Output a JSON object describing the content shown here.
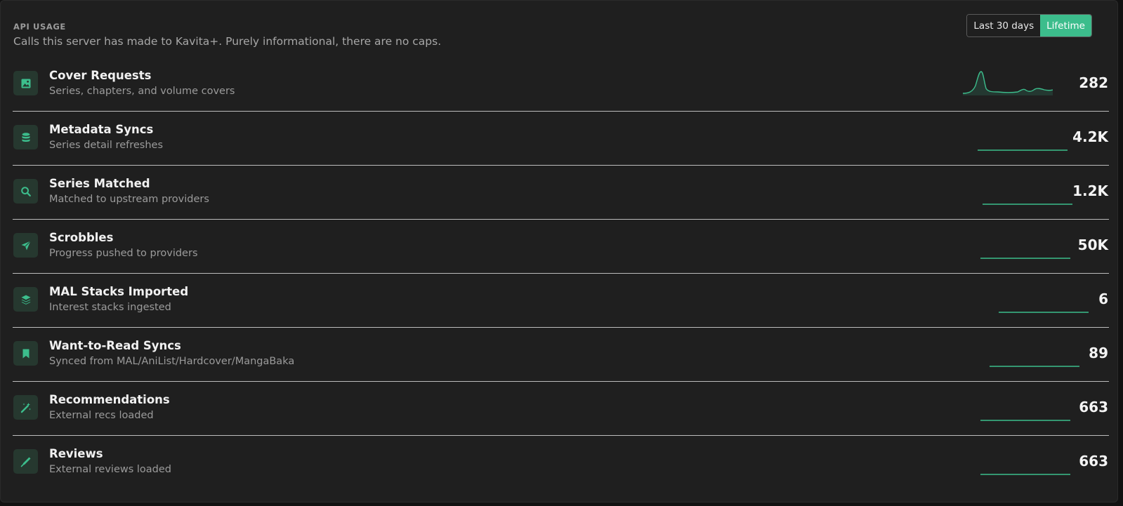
{
  "section": {
    "title": "API USAGE",
    "description": "Calls this server has made to Kavita+. Purely informational, there are no caps."
  },
  "range_toggle": {
    "options": [
      "Last 30 days",
      "Lifetime"
    ],
    "selected": "Lifetime"
  },
  "colors": {
    "accent": "#3cbd8c",
    "icon_bg": "#26382f",
    "panel_bg": "#1f1f1f"
  },
  "metrics": [
    {
      "title": "Cover Requests",
      "subtitle": "Series, chapters, and volume covers",
      "value": "282",
      "icon": "image-icon"
    },
    {
      "title": "Metadata Syncs",
      "subtitle": "Series detail refreshes",
      "value": "4.2K",
      "icon": "database-icon"
    },
    {
      "title": "Series Matched",
      "subtitle": "Matched to upstream providers",
      "value": "1.2K",
      "icon": "search-icon"
    },
    {
      "title": "Scrobbles",
      "subtitle": "Progress pushed to providers",
      "value": "50K",
      "icon": "send-icon"
    },
    {
      "title": "MAL Stacks Imported",
      "subtitle": "Interest stacks ingested",
      "value": "6",
      "icon": "layers-icon"
    },
    {
      "title": "Want-to-Read Syncs",
      "subtitle": "Synced from MAL/AniList/Hardcover/MangaBaka",
      "value": "89",
      "icon": "bookmark-icon"
    },
    {
      "title": "Recommendations",
      "subtitle": "External recs loaded",
      "value": "663",
      "icon": "magic-wand-icon"
    },
    {
      "title": "Reviews",
      "subtitle": "External reviews loaded",
      "value": "663",
      "icon": "pen-icon"
    }
  ]
}
